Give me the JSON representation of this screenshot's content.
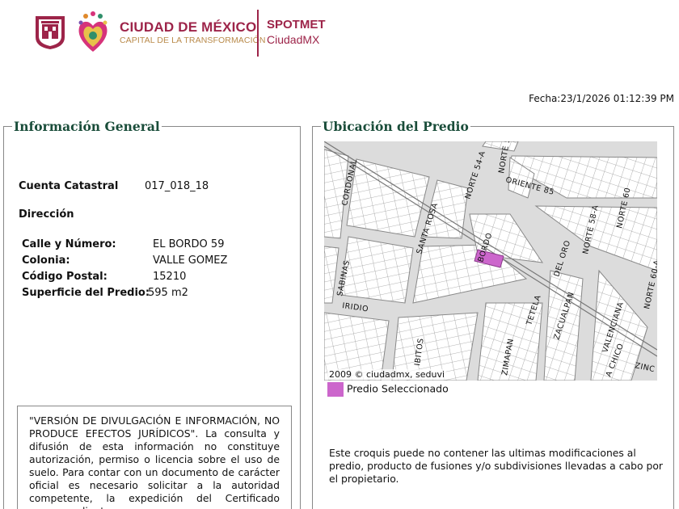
{
  "header": {
    "brand_title": "CIUDAD DE MÉXICO",
    "brand_subtitle": "CAPITAL DE LA TRANSFORMACIÓN",
    "app_title": "SPOTMET",
    "app_subtitle": "CiudadMX",
    "shield_icon": "cdmx-shield-icon",
    "heart_icon": "heart-logo-icon",
    "brand_color": "#9d2449"
  },
  "fecha": "Fecha:23/1/2026 01:12:39 PM",
  "general": {
    "legend": "Información General",
    "cuenta_label": "Cuenta Catastral",
    "cuenta_value": "017_018_18",
    "direccion_label": "Dirección",
    "calle_label": "Calle y Número:",
    "calle_value": "EL BORDO 59",
    "colonia_label": "Colonia:",
    "colonia_value": "VALLE GOMEZ",
    "cp_label": "Código Postal:",
    "cp_value": "15210",
    "superficie_label": "Superficie del Predio:",
    "superficie_value": "595 m2",
    "disclaimer": "\"VERSIÓN DE DIVULGACIÓN E INFORMACIÓN, NO PRODUCE EFECTOS JURÍDICOS\". La consulta y difusión de esta información no constituye autorización, permiso o licencia sobre el uso de suelo. Para contar con un documento de carácter oficial es necesario solicitar a la autoridad competente, la expedición del Certificado correspondiente."
  },
  "ubicacion": {
    "legend": "Ubicación del Predio",
    "map_credit": "2009 © ciudadmx, seduvi",
    "legend_item": "Predio Seleccionado",
    "highlight_color": "#cc66cc",
    "note": "Este croquis puede no contener las ultimas modificaciones al predio, producto de fusiones y/o subdivisiones llevadas a cabo por el propietario.",
    "streets": {
      "cordonal": "CORDONAL",
      "santa_rosa": "SANTA ROSA",
      "norte_54a": "NORTE 54-A",
      "norte_5": "NORTE 5",
      "oriente_85": "ORIENTE 85",
      "norte_58a": "NORTE 58-A",
      "norte_60": "NORTE 60",
      "norte_60a": "NORTE 60-A",
      "bordo": "BORDO",
      "del_oro": "DEL ORO",
      "tetela": "TETELA",
      "sabinas": "SABINAS",
      "iridio": "IRIDIO",
      "zacualpan": "ZACUALPAN",
      "valenciana": "VALENCIANA",
      "bitos": "IBITOS",
      "zimapan": "ZIMAPAN",
      "chico": "A CHICO",
      "zinc": "ZINC"
    }
  }
}
